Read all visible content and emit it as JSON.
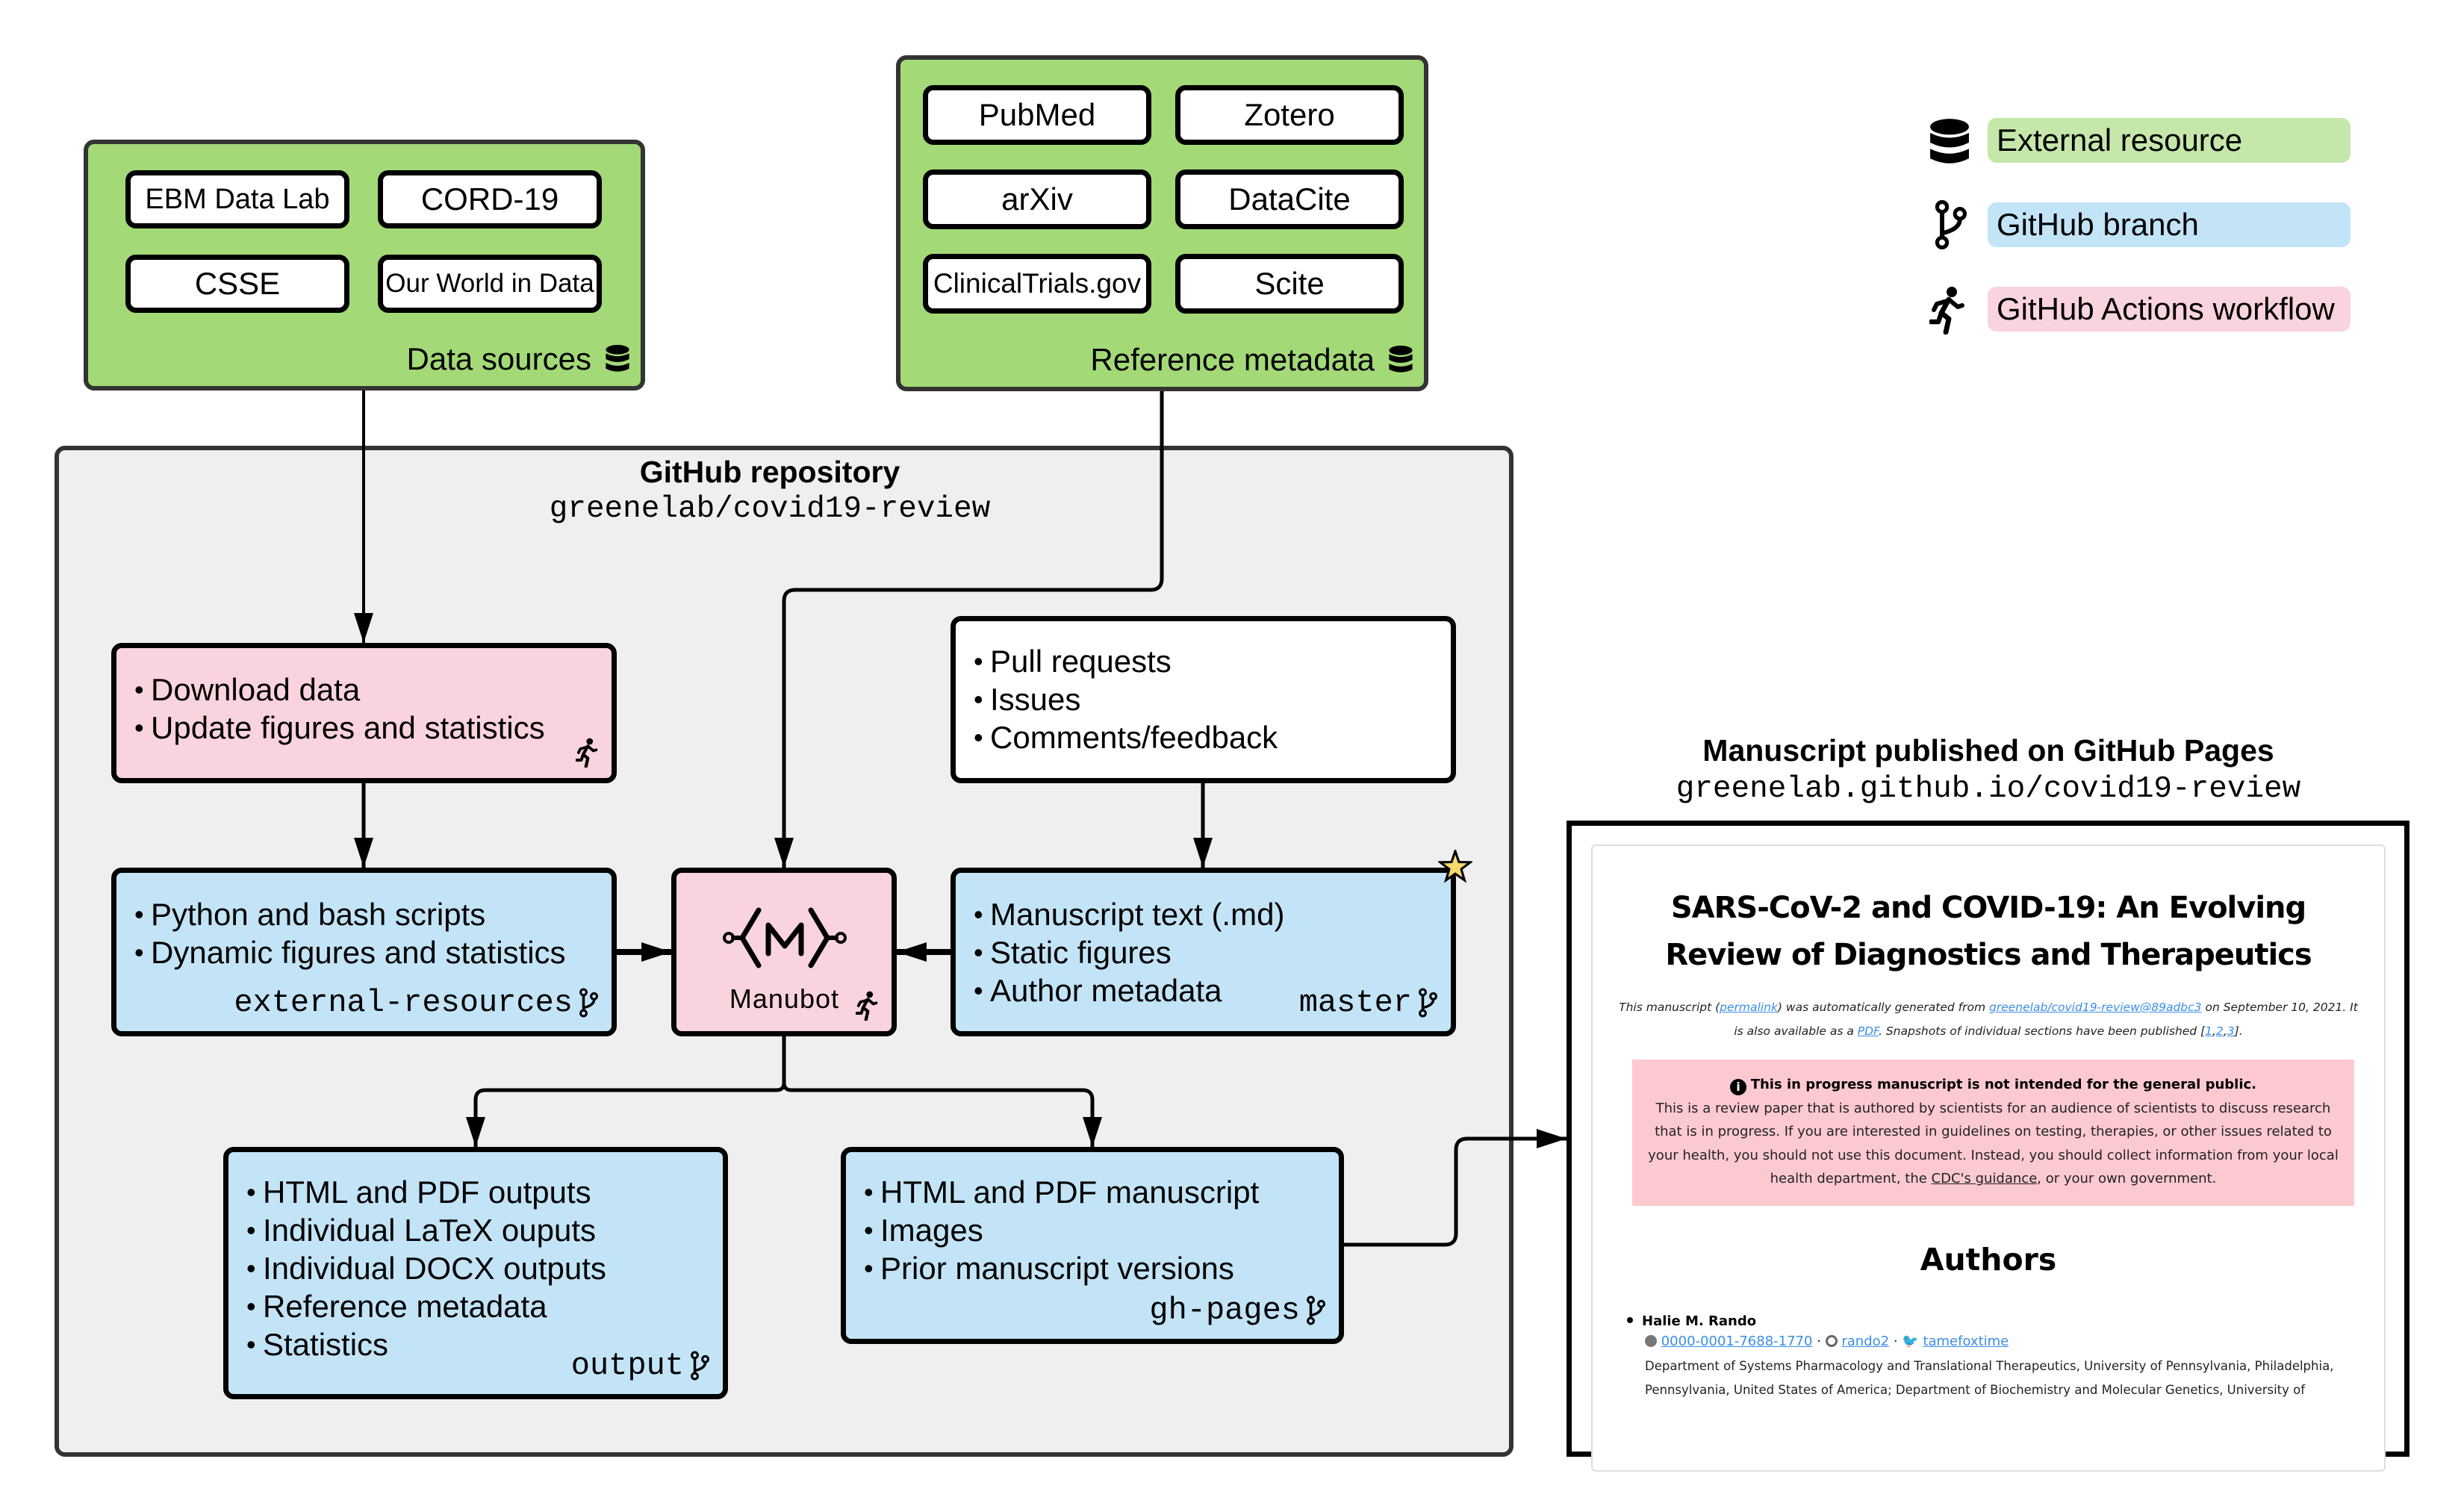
{
  "legend": {
    "items": [
      {
        "icon": "database-icon",
        "label": "External resource",
        "color": "#c6e7aa"
      },
      {
        "icon": "git-branch-icon",
        "label": "GitHub branch",
        "color": "#c2e4f6"
      },
      {
        "icon": "running-person-icon",
        "label": "GitHub Actions workflow",
        "color": "#f9d3de"
      }
    ]
  },
  "data_sources": {
    "label": "Data sources",
    "items": [
      "EBM Data Lab",
      "CORD-19",
      "CSSE",
      "Our World in Data"
    ]
  },
  "reference_metadata": {
    "label": "Reference metadata",
    "items": [
      "PubMed",
      "Zotero",
      "arXiv",
      "DataCite",
      "ClinicalTrials.gov",
      "Scite"
    ]
  },
  "repository": {
    "title": "GitHub repository",
    "slug": "greenelab/covid19-review",
    "download_workflow": {
      "items": [
        "Download data",
        "Update figures and statistics"
      ]
    },
    "external_resources_branch": {
      "items": [
        "Python and bash scripts",
        "Dynamic figures and statistics"
      ],
      "branch": "external-resources"
    },
    "manubot": {
      "logo_letter": "M",
      "label": "Manubot"
    },
    "contributions": {
      "items": [
        "Pull requests",
        "Issues",
        "Comments/feedback"
      ]
    },
    "master_branch": {
      "items": [
        "Manuscript text (.md)",
        "Static figures",
        "Author metadata"
      ],
      "branch": "master",
      "default_marker": "star-icon"
    },
    "output_branch": {
      "items": [
        "HTML and PDF outputs",
        "Individual LaTeX ouputs",
        "Individual DOCX outputs",
        "Reference metadata",
        "Statistics"
      ],
      "branch": "output"
    },
    "ghpages_branch": {
      "items": [
        "HTML and PDF manuscript",
        "Images",
        "Prior manuscript versions"
      ],
      "branch": "gh-pages"
    }
  },
  "published": {
    "title": "Manuscript published on GitHub Pages",
    "url": "greenelab.github.io/covid19-review",
    "manuscript": {
      "title": "SARS-CoV-2 and COVID-19: An Evolving Review of Diagnostics and Therapeutics",
      "meta_prefix": "This manuscript (",
      "meta_permalink": "permalink",
      "meta_mid": ") was automatically generated from ",
      "meta_commit": "greenelab/covid19-review@89adbc3",
      "meta_date": " on September 10, 2021. It is also available as a ",
      "meta_pdf": "PDF",
      "meta_snapshots": ". Snapshots of individual sections have been published [",
      "meta_snap1": "1",
      "meta_snap2": "2",
      "meta_snap3": "3",
      "meta_end": "].",
      "alert_title": "This in progress manuscript is not intended for the general public.",
      "alert_body_1": "This is a review paper that is authored by scientists for an audience of scientists to discuss research that is in progress. If you are interested in guidelines on testing, therapies, or other issues related to your health, you should not use this document. Instead, you should collect information from your local health department, the ",
      "alert_link": "CDC's guidance",
      "alert_body_2": ", or your own government.",
      "authors_heading": "Authors",
      "author": {
        "name": "Halie M. Rando",
        "orcid": "0000-0001-7688-1770",
        "github": "rando2",
        "twitter": "tamefoxtime",
        "affiliation": "Department of Systems Pharmacology and Translational Therapeutics, University of Pennsylvania, Philadelphia, Pennsylvania, United States of America; Department of Biochemistry and Molecular Genetics, University of"
      }
    }
  }
}
